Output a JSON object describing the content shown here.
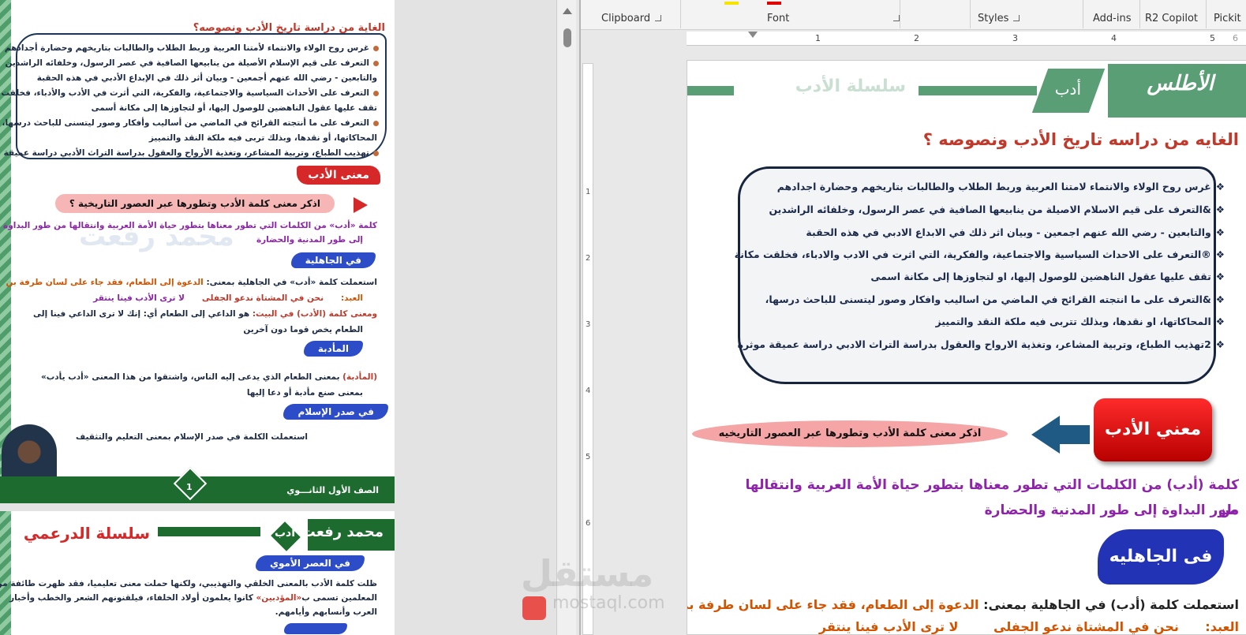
{
  "ribbon": {
    "groups": [
      "Clipboard",
      "Font",
      "Styles",
      "Add-ins",
      "R2 Copilot",
      "Pickit"
    ]
  },
  "ruler": {
    "h_ticks": [
      "1",
      "2",
      "3",
      "4",
      "5",
      "6"
    ],
    "v_ticks": [
      "1",
      "2",
      "3",
      "4",
      "5",
      "6"
    ]
  },
  "pdf_page1": {
    "title": "الغاية من دراسة تاريخ الأدب ونصوصه؟",
    "bullets": [
      "غرس روح الولاء والانتماء لأمتنا العربية وربط الطلاب والطالبات بتاريخهم وحضارة أجدادهم",
      "التعرف على قيم الإسلام الأصيلة من ينابيعها الصافية في عصر الرسول، وخلفائه الراشدين",
      "والتابعين - رضي الله عنهم أجمعين - وبيان أثر ذلك في الإبداع الأدبي في هذه الحقبة",
      "التعرف على الأحداث السياسية والاجتماعية، والفكرية، التي أثرت في الأدب والأدباء، فخلقت مكانة",
      "تقف عليها عقول الناهضين للوصول إليها، أو لتجاوزها إلى مكانة أسمى",
      "التعرف على ما أنتجته القرائح في الماضي من أساليب وأفكار وصور ليتسنى للباحث درسها،",
      "المحاكاتها، أو نقدها، وبذلك تربى فيه ملكة النقد والتمييز",
      "تهذيب الطباع، وتربية المشاعر، وتغذية الأرواح والعقول بدراسة التراث الأدبي دراسة عميقة موثرة"
    ],
    "meaning_banner": "معنى الأدب",
    "question": "اذكر معنى كلمة الأدب وتطورها عبر العصور التاريخية ؟",
    "def_line1": "كلمة «أدب» من الكلمات التي تطور معناها بتطور حياة الأمة العربية وانتقالها من طور البداوة",
    "def_line2": "إلى طور المدنية والحضارة",
    "jahiliya_label": "في الجاهلية",
    "jahiliya_line1_a": "استعملت كلمة «أدب» في الجاهلية بمعنى:",
    "jahiliya_line1_b": "الدعوة إلى الطعام، فقد جاء على لسان طرفة بن",
    "jahiliya_line2_a": "العبد:",
    "jahiliya_line2_b": "نحن في المشتاة ندعو الجفلى",
    "jahiliya_line2_c": "لا ترى الأدب فينا ينتقر",
    "verse_line_a": "ومعنى كلمة (الأدب) في البيت:",
    "verse_line_b": "هو الداعي إلى الطعام أي: إنك لا ترى الداعي فينا إلى",
    "verse_line2": "الطعام يخص قوما دون آخرين",
    "ma2duba_label": "المأدبة",
    "ma2duba_line1_a": "(المأدبة)",
    "ma2duba_line1_b": "بمعنى الطعام الذي يدعى إليه الناس، واشتقوا من هذا المعنى «أدب يأدب»",
    "ma2duba_line2": "بمعنى صنع مأدبة أو دعا إليها",
    "islam_label": "في صدر الإسلام",
    "islam_line": "استعملت الكلمة في صدر الإسلام بمعنى التعليم والتثقيف",
    "footer_grade": "الصف الأول الثانـــوي",
    "page_number": "1",
    "watermark": "محمد رفعت"
  },
  "pdf_page2": {
    "teacher": "محمد رفعت",
    "subject": "أدب",
    "series": "سلسلة الدرعمي",
    "umayyad_label": "في العصر الأموي",
    "line1": "ظلت كلمة الأدب بالمعنى الخلقي والتهذيبي، ولكنها حملت معنى تعليميا، فقد ظهرت طائفة من",
    "line2_a": "المعلمين تسمى ب",
    "line2_b": "«المؤدبين»",
    "line2_c": "كانوا يعلمون أولاد الخلفاء، فيلقنونهم الشعر والخطب وأخبار",
    "line3": "العرب وأنسابهم وأيامهم."
  },
  "word_doc": {
    "logo": "الأطلس",
    "subject": "أدب",
    "series": "سلسلة الأدب",
    "title": "الغايه من دراسه تاريخ الأدب ونصوصه ؟",
    "bullets": [
      "غرس روح الولاء والانتماء لامتنا العربية وربط الطلاب والطالبات بتاريخهم وحضارة اجدادهم",
      "&التعرف على قيم الاسلام الاصيلة من ينابيعها الصافية في عصر الرسول، وخلفائه الراشدين",
      "والتابعين - رضي الله عنهم اجمعين - وبيان اثر ذلك في الابداع الادبي في هذه الحقبة",
      "®التعرف على الاحداث السياسية والاجتماعية، والفكرية، التي اثرت في الادب والادباء، فخلقت مكانة",
      "تقف عليها عقول الناهضين للوصول إليها، او لتجاوزها إلى مكانة اسمى",
      "&التعرف على ما انتجته القرائح في الماضي من اساليب وافكار وصور ليتسنى للباحث درسها،",
      "المحاكاتها، او نقدها، وبذلك تتربى فيه ملكة النقد والتمييز",
      "2تهذيب الطباع، وتربية المشاعر، وتغذية الارواح والعقول بدراسة التراث الادبي دراسة عميقة موثرة"
    ],
    "meaning_button": "معني الأدب",
    "question": "اذكر معنى كلمة الأدب وتطورها عبر العصور التاريخيه",
    "def_line1": "كلمة (أدب) من الكلمات التي تطور معناها بتطور حياة الأمة العربية وانتقالها من",
    "def_line2": "طور البداوة إلى طور المدنية والحضارة",
    "jahiliya_label": "فى الجاهليه",
    "jahiliya_a": "استعملت كلمة (أدب) في الجاهلية بمعنى:",
    "jahiliya_b": "الدعوة إلى الطعام، فقد جاء على لسان طرفة بن",
    "jahiliya2_a": "العبد:",
    "jahiliya2_b": "نحن في المشتاة ندعو الجفلى",
    "jahiliya2_c": "لا ترى الأدب فينا ينتقر"
  },
  "watermark": {
    "brand_ar": "مستقل",
    "brand_en": "mostaql.com"
  },
  "colors": {
    "green": "#1e6b30",
    "red": "#d62828",
    "navy": "#17243e",
    "blue": "#2234b5",
    "purple": "#8e24aa"
  }
}
